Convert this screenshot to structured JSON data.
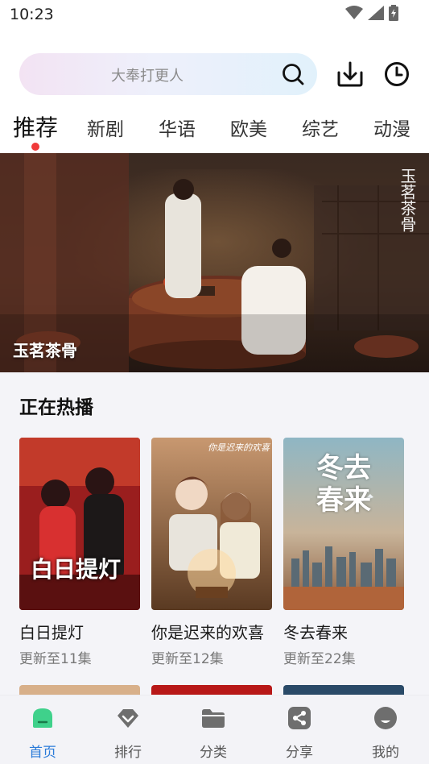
{
  "status_bar": {
    "time": "10:23"
  },
  "search": {
    "placeholder": "大奉打更人"
  },
  "tabs": [
    {
      "label": "推荐",
      "active": true
    },
    {
      "label": "新剧"
    },
    {
      "label": "华语"
    },
    {
      "label": "欧美"
    },
    {
      "label": "综艺"
    },
    {
      "label": "动漫"
    }
  ],
  "banner": {
    "title": "玉茗茶骨",
    "logo_text": "玉茗茶骨"
  },
  "section": {
    "title": "正在热播",
    "items": [
      {
        "title": "白日提灯",
        "subtitle": "更新至11集",
        "poster_text": "白日提灯"
      },
      {
        "title": "你是迟来的欢喜",
        "subtitle": "更新至12集",
        "poster_text": "你是迟来的欢喜"
      },
      {
        "title": "冬去春来",
        "subtitle": "更新至22集",
        "poster_text": "冬去春来"
      }
    ]
  },
  "bottom_nav": [
    {
      "label": "首页",
      "icon": "home-icon",
      "active": true
    },
    {
      "label": "排行",
      "icon": "ranking-icon"
    },
    {
      "label": "分类",
      "icon": "category-folder-icon"
    },
    {
      "label": "分享",
      "icon": "share-icon"
    },
    {
      "label": "我的",
      "icon": "profile-icon"
    }
  ],
  "colors": {
    "accent": "#2b7bd9",
    "tab_dot": "#f03a3a",
    "home_icon": "#3fd18b"
  }
}
